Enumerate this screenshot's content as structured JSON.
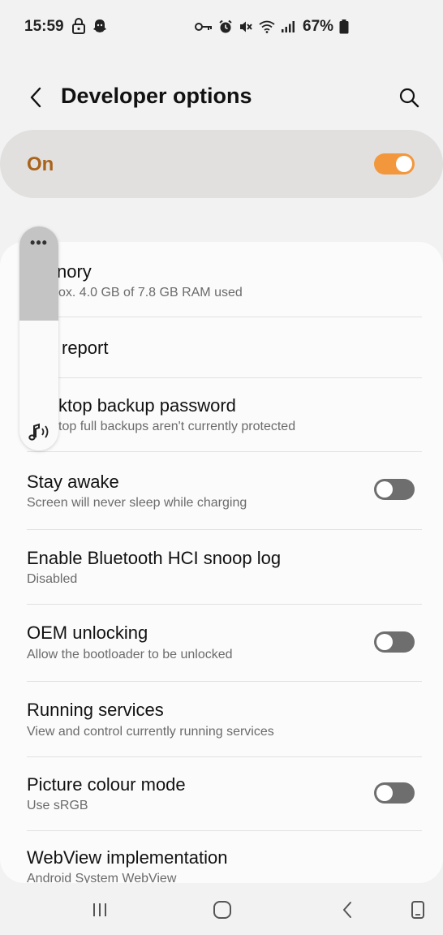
{
  "status_bar": {
    "time": "15:59",
    "left_icons": [
      "lock-icon",
      "snapchat-ghost-icon"
    ],
    "right_icons": [
      "vpn-key-icon",
      "alarm-icon",
      "mute-icon",
      "wifi-icon",
      "signal-icon"
    ],
    "battery_percent": "67%"
  },
  "header": {
    "title": "Developer options",
    "back_icon": "back-chevron-icon",
    "search_icon": "search-icon"
  },
  "master_switch": {
    "label": "On",
    "state": true,
    "accent_color": "#f3973c",
    "label_color": "#a9631b"
  },
  "settings": [
    {
      "title": "Memory",
      "visible_title": "nory",
      "subtitle": "ox. 4.0 GB of 7.8 GB RAM used"
    },
    {
      "title": "Bug report",
      "visible_title": "report",
      "subtitle": ""
    },
    {
      "title": "Desktop backup password",
      "visible_title": "ktop backup password",
      "subtitle": "top full backups aren't currently protected"
    },
    {
      "title": "Stay awake",
      "subtitle": "Screen will never sleep while charging",
      "toggle": false
    },
    {
      "title": "Enable Bluetooth HCI snoop log",
      "subtitle": "Disabled"
    },
    {
      "title": "OEM unlocking",
      "subtitle": "Allow the bootloader to be unlocked",
      "toggle": false
    },
    {
      "title": "Running services",
      "subtitle": "View and control currently running services"
    },
    {
      "title": "Picture colour mode",
      "subtitle": "Use sRGB",
      "toggle": false
    },
    {
      "title": "WebView implementation",
      "subtitle": "Android System WebView"
    }
  ],
  "volume_panel": {
    "more_label": "•••",
    "stream_icon": "music-note-icon",
    "level": 0.42
  },
  "nav_bar": {
    "icons": [
      "recents-icon",
      "home-icon",
      "back-icon",
      "rotate-icon"
    ]
  }
}
